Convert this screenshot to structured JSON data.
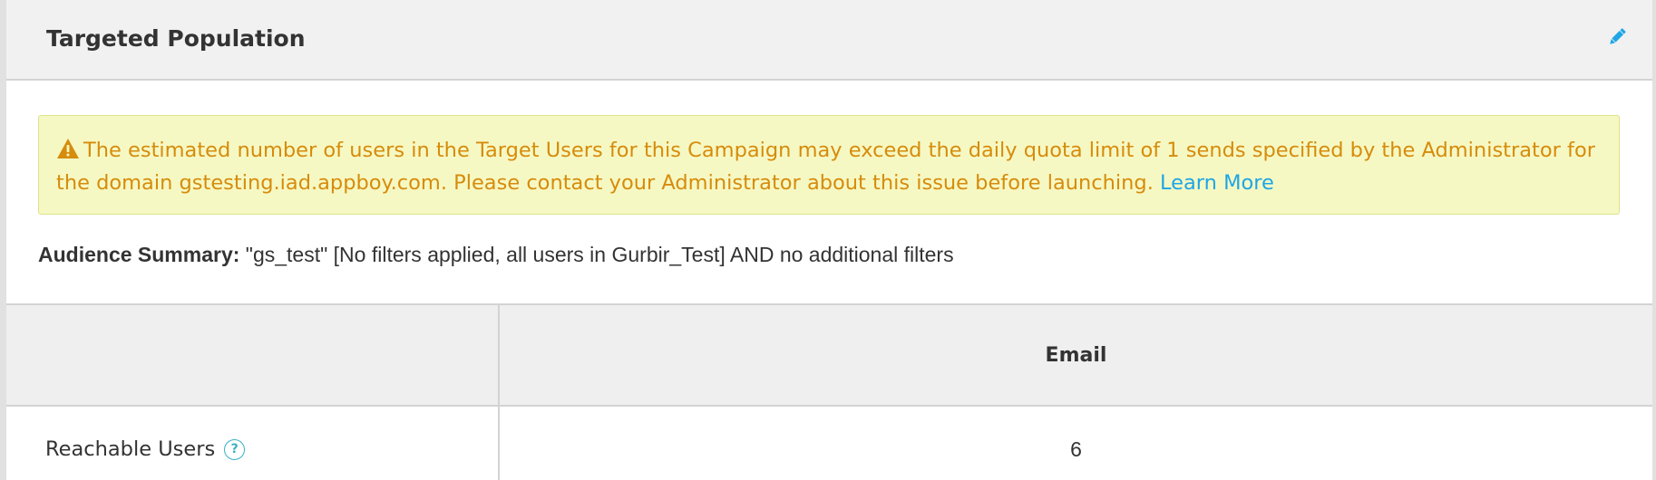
{
  "panel": {
    "title": "Targeted Population"
  },
  "warning": {
    "message": "The estimated number of users in the Target Users for this Campaign may exceed the daily quota limit of 1 sends specified by the Administrator for the domain gstesting.iad.appboy.com. Please contact your Administrator about this issue before launching.",
    "link_label": "Learn More",
    "text_color": "#d68c0c",
    "background_color": "#f6f8c3"
  },
  "summary": {
    "label": "Audience Summary:",
    "text": "\"gs_test\" [No filters applied, all users in Gurbir_Test] AND no additional filters"
  },
  "table": {
    "columns": [
      "",
      "Email"
    ],
    "rows": [
      {
        "label": "Reachable Users",
        "help": "?",
        "value": "6"
      }
    ]
  },
  "icons": {
    "edit": "pencil-icon",
    "warning": "warning-triangle-icon",
    "help": "question-circle-icon"
  },
  "colors": {
    "accent": "#1ea6e6",
    "help": "#38b2c4"
  }
}
